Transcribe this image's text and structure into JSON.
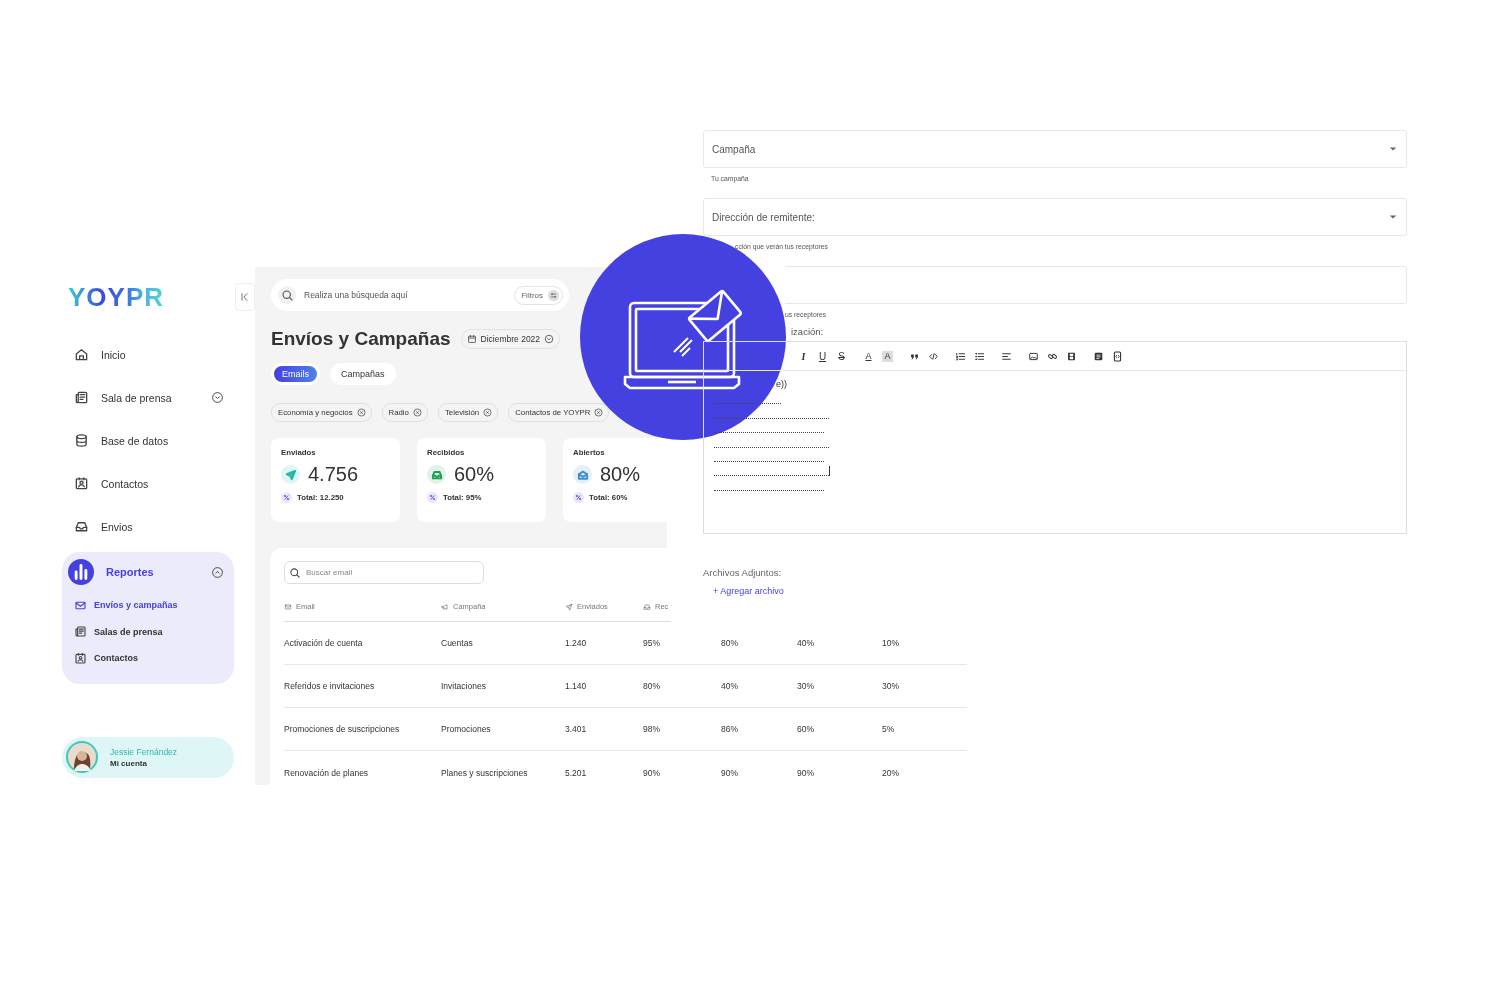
{
  "sidebar": {
    "logo": "YOYPR",
    "items": [
      {
        "kind": "link",
        "label": "Inicio",
        "selected": false
      },
      {
        "kind": "group",
        "label": "Sala de prensa",
        "selected": false,
        "expanded": false
      },
      {
        "kind": "link",
        "label": "Base de datos",
        "selected": false
      },
      {
        "kind": "link",
        "label": "Contactos",
        "selected": false
      },
      {
        "kind": "link",
        "label": "Envios",
        "selected": false
      },
      {
        "kind": "group",
        "label": "Reportes",
        "selected": true,
        "expanded": true,
        "children": [
          {
            "label": "Envíos y campañas",
            "selected": true
          },
          {
            "label": "Salas de prensa",
            "selected": false
          },
          {
            "label": "Contactos",
            "selected": false
          }
        ]
      }
    ],
    "user": {
      "name": "Jessie Fernández",
      "link": "Mi cuenta"
    }
  },
  "main": {
    "search": {
      "placeholder": "Realiza una búsqueda aquí",
      "filter": "Filtros"
    },
    "title": "Envíos y Campañas",
    "date": "Diciembre 2022",
    "tabs": [
      {
        "label": "Emails",
        "selected": true
      },
      {
        "label": "Campañas",
        "selected": false
      }
    ],
    "chips": [
      "Economía y negocios",
      "Radio",
      "Televisión",
      "Contactos de YOYPR"
    ],
    "stats": [
      {
        "label": "Enviados",
        "value": "4.756",
        "total": "Total: 12.250",
        "color": "#1fb5a8"
      },
      {
        "label": "Recibidos",
        "value": "60%",
        "total": "Total: 95%",
        "color": "#1f9d55"
      },
      {
        "label": "Abiertos",
        "value": "80%",
        "total": "Total: 60%",
        "color": "#3c8fcf"
      }
    ]
  },
  "table": {
    "search": {
      "placeholder": "Buscar email"
    },
    "columns": [
      "Email",
      "Campaña",
      "Enviados",
      "Rec"
    ],
    "rows": [
      [
        "Activación de cuenta",
        "Cuentas",
        "1.240",
        "95%",
        "80%",
        "40%",
        "10%"
      ],
      [
        "Referidos e invitaciones",
        "Invitaciones",
        "1.140",
        "80%",
        "40%",
        "30%",
        "30%"
      ],
      [
        "Promociones de suscripciones",
        "Promociones",
        "3.401",
        "98%",
        "86%",
        "60%",
        "5%"
      ],
      [
        "Renovación de planes",
        "Planes y suscripciones",
        "5.201",
        "90%",
        "90%",
        "90%",
        "20%"
      ]
    ]
  },
  "form": {
    "fields": [
      {
        "kind": "select",
        "label": "Campaña",
        "helper": "Tu campaña"
      },
      {
        "kind": "select",
        "label": "Dirección de remitente:",
        "helper": "cción que verán tus receptores"
      },
      {
        "kind": "text",
        "helper": "us receptores"
      }
    ],
    "editor": {
      "label": "ización:",
      "text": "e))",
      "toolbar": [
        [
          {
            "kind": "italic",
            "label": "I"
          },
          {
            "kind": "underline",
            "label": "U"
          },
          {
            "kind": "strike",
            "label": "S"
          }
        ],
        [
          {
            "kind": "text-color",
            "label": "A"
          },
          {
            "kind": "highlight",
            "label": "A"
          }
        ],
        [
          {
            "kind": "quote"
          },
          {
            "kind": "code"
          }
        ],
        [
          {
            "kind": "ordered-list"
          },
          {
            "kind": "bullet-list"
          }
        ],
        [
          {
            "kind": "align"
          }
        ],
        [
          {
            "kind": "image"
          },
          {
            "kind": "link"
          },
          {
            "kind": "video"
          }
        ],
        [
          {
            "kind": "template"
          },
          {
            "kind": "source"
          }
        ]
      ]
    },
    "attachments": {
      "label": "Archivos Adjuntos:",
      "link": "+ Agregar archivo"
    }
  }
}
